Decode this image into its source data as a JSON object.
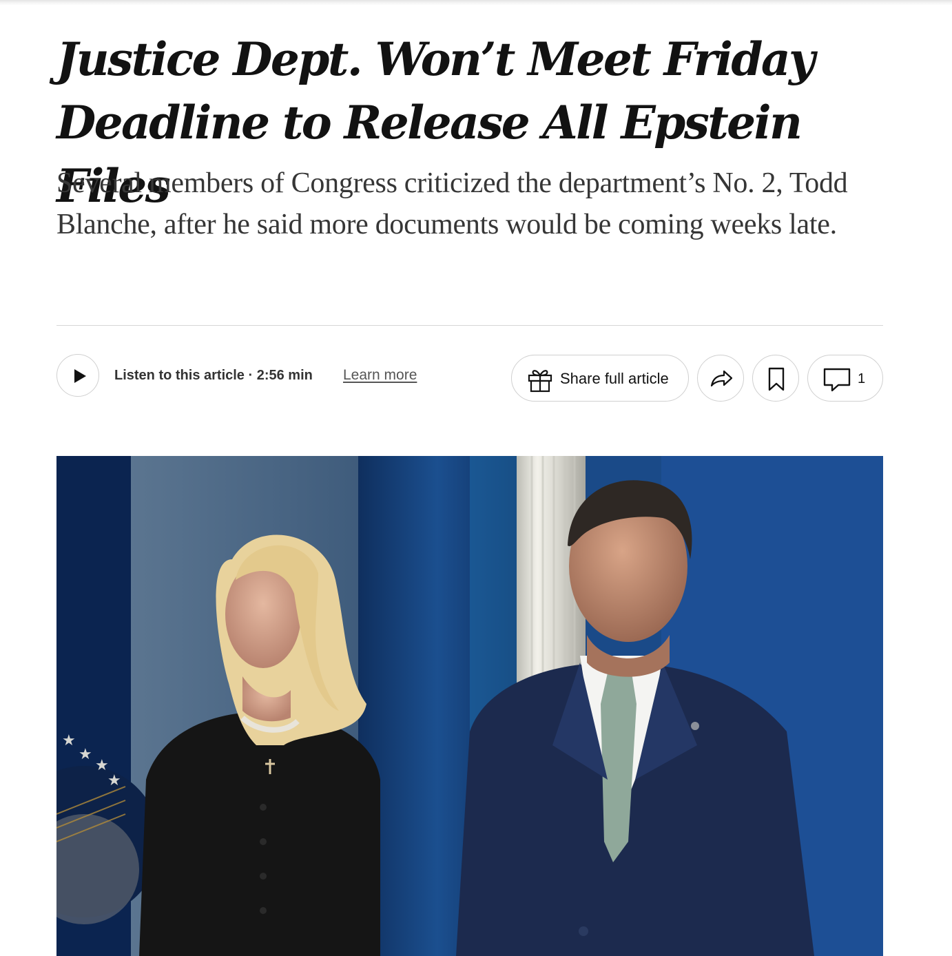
{
  "article": {
    "headline": "Justice Dept. Won’t Meet Friday Deadline to Release All Epstein Files",
    "summary": "Several members of Congress criticized the department’s No. 2, Todd Blanche, after he said more documents would be coming weeks late."
  },
  "toolbar": {
    "listen_label": "Listen to this article · 2:56 min",
    "learn_more": "Learn more",
    "share_full_label": "Share full article",
    "comment_count": "1",
    "icons": {
      "play": "play-icon",
      "gift": "gift-icon",
      "share": "share-arrow-icon",
      "bookmark": "bookmark-icon",
      "comment": "comment-bubble-icon"
    }
  },
  "photo": {
    "description_colors": {
      "background_blue": "#123a72",
      "suit_navy": "#1c2a4e",
      "hair_blonde": "#e6cf96",
      "tie_green": "#8fa89a"
    }
  }
}
